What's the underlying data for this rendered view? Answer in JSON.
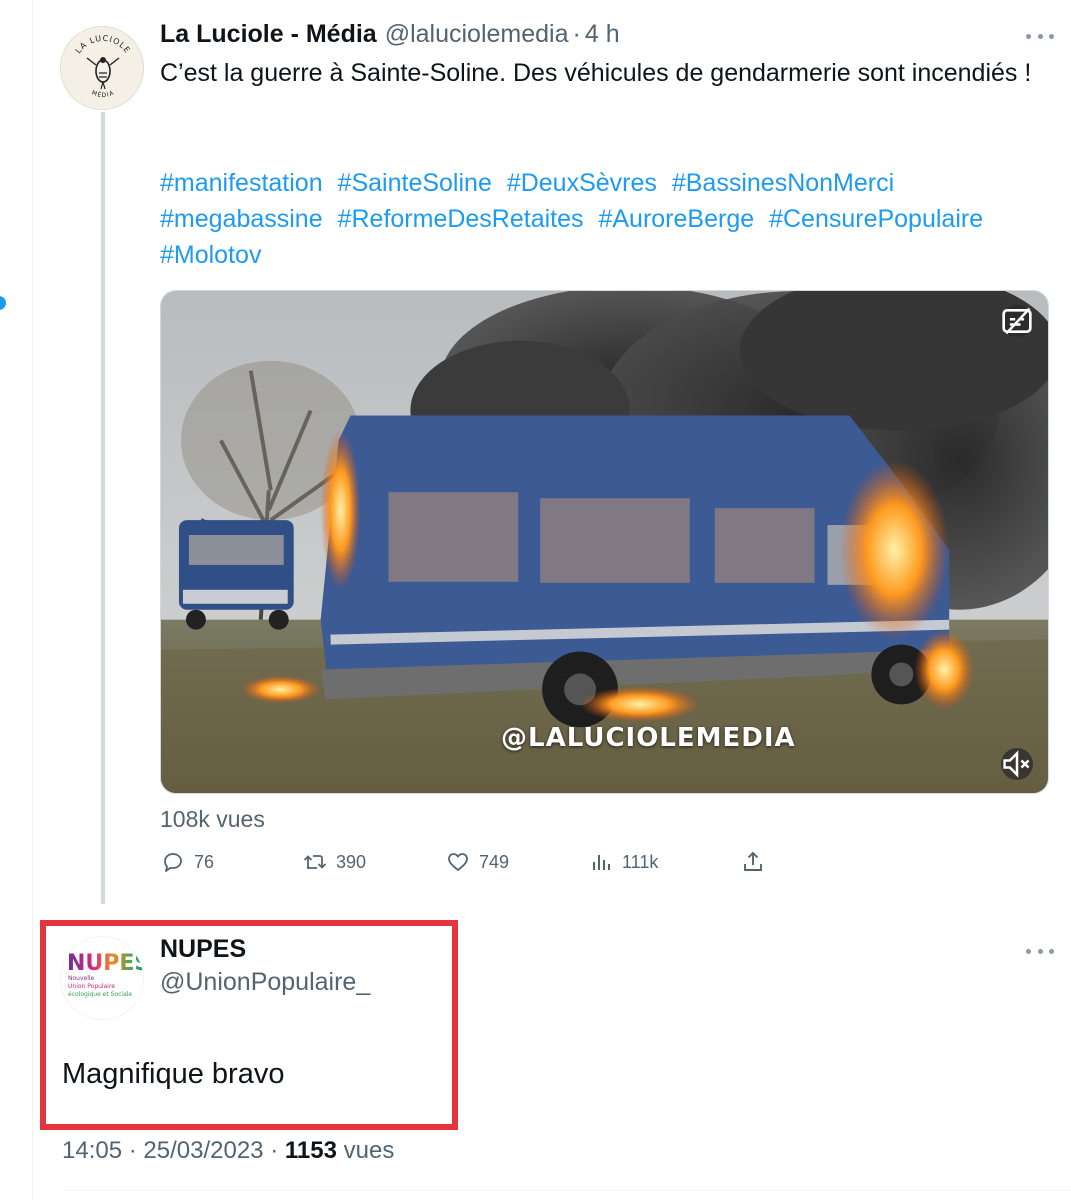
{
  "tweet": {
    "author_name": "La Luciole - Média",
    "handle": "@lalucio lemedia",
    "handle_display": "@laluciolemedia",
    "separator": "·",
    "time": "4 h",
    "text": "C’est la guerre à Sainte-Soline. Des véhicules de gendarmerie sont incendiés !",
    "hashtags": [
      "#manifestation",
      "#SainteSoline",
      "#DeuxSèvres",
      "#BassinesNonMerci",
      "#megabassine",
      "#ReformeDesRetaites",
      "#AuroreBerge",
      "#CensurePopulaire",
      "#Molotov"
    ],
    "avatar_text_top": "LA LUCIOLE",
    "avatar_text_bottom": "MÉDIA",
    "media_watermark": "@LALUCIOLEMEDIA",
    "views": "108k vues",
    "actions": {
      "replies": "76",
      "retweets": "390",
      "likes": "749",
      "views": "111k"
    },
    "icons": [
      "more-icon",
      "reply-icon",
      "retweet-icon",
      "like-icon",
      "views-chart-icon",
      "share-icon",
      "captions-icon",
      "mute-icon"
    ]
  },
  "reply": {
    "author_name": "NUPES",
    "handle": "@UnionPopulaire_",
    "text": "Magnifique bravo",
    "avatar_logo": "NUPES",
    "avatar_lines": [
      "Nouvelle",
      "Union Populaire",
      "écologique et Sociale"
    ],
    "time": "14:05",
    "date": "25/03/2023",
    "separator": "·",
    "views_count": "1153",
    "views_label": "vues"
  },
  "colors": {
    "accent": "#1d9bf0",
    "secondary_text": "#536471",
    "highlight": "#e4353e",
    "thread_line": "#cfd9de"
  }
}
